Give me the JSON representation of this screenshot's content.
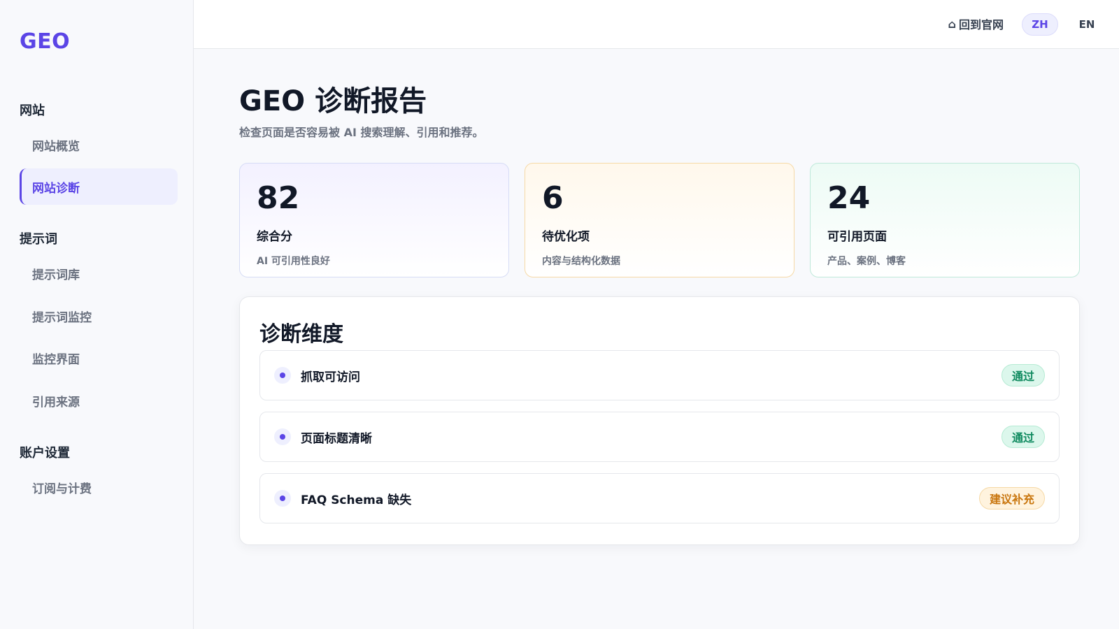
{
  "brand": {
    "logo": "GEO"
  },
  "sidebar": {
    "groups": [
      {
        "title": "网站",
        "items": [
          {
            "label": "网站概览"
          },
          {
            "label": "网站诊断",
            "active": true
          }
        ]
      },
      {
        "title": "提示词",
        "items": [
          {
            "label": "提示词库"
          },
          {
            "label": "提示词监控"
          },
          {
            "label": "监控界面"
          },
          {
            "label": "引用来源"
          }
        ]
      },
      {
        "title": "账户设置",
        "items": [
          {
            "label": "订阅与计费"
          }
        ]
      }
    ]
  },
  "topbar": {
    "back_icon": "home-icon",
    "back_glyph": "⌂",
    "back_label": "回到官网",
    "lang_zh": "ZH",
    "lang_en": "EN",
    "active_lang": "ZH"
  },
  "page": {
    "title": "GEO 诊断报告",
    "subtitle": "检查页面是否容易被 AI 搜索理解、引用和推荐。"
  },
  "stats": [
    {
      "value": "82",
      "label": "综合分",
      "desc": "AI 可引用性良好"
    },
    {
      "value": "6",
      "label": "待优化项",
      "desc": "内容与结构化数据"
    },
    {
      "value": "24",
      "label": "可引用页面",
      "desc": "产品、案例、博客"
    }
  ],
  "dimensions": {
    "title": "诊断维度",
    "items": [
      {
        "label": "抓取可访问",
        "status": "通过",
        "status_type": "pass"
      },
      {
        "label": "页面标题清晰",
        "status": "通过",
        "status_type": "pass"
      },
      {
        "label": "FAQ Schema 缺失",
        "status": "建议补充",
        "status_type": "warn"
      }
    ]
  },
  "colors": {
    "accent": "#5b45e6",
    "pass": "#0f8a5f",
    "warn": "#c9760e"
  }
}
